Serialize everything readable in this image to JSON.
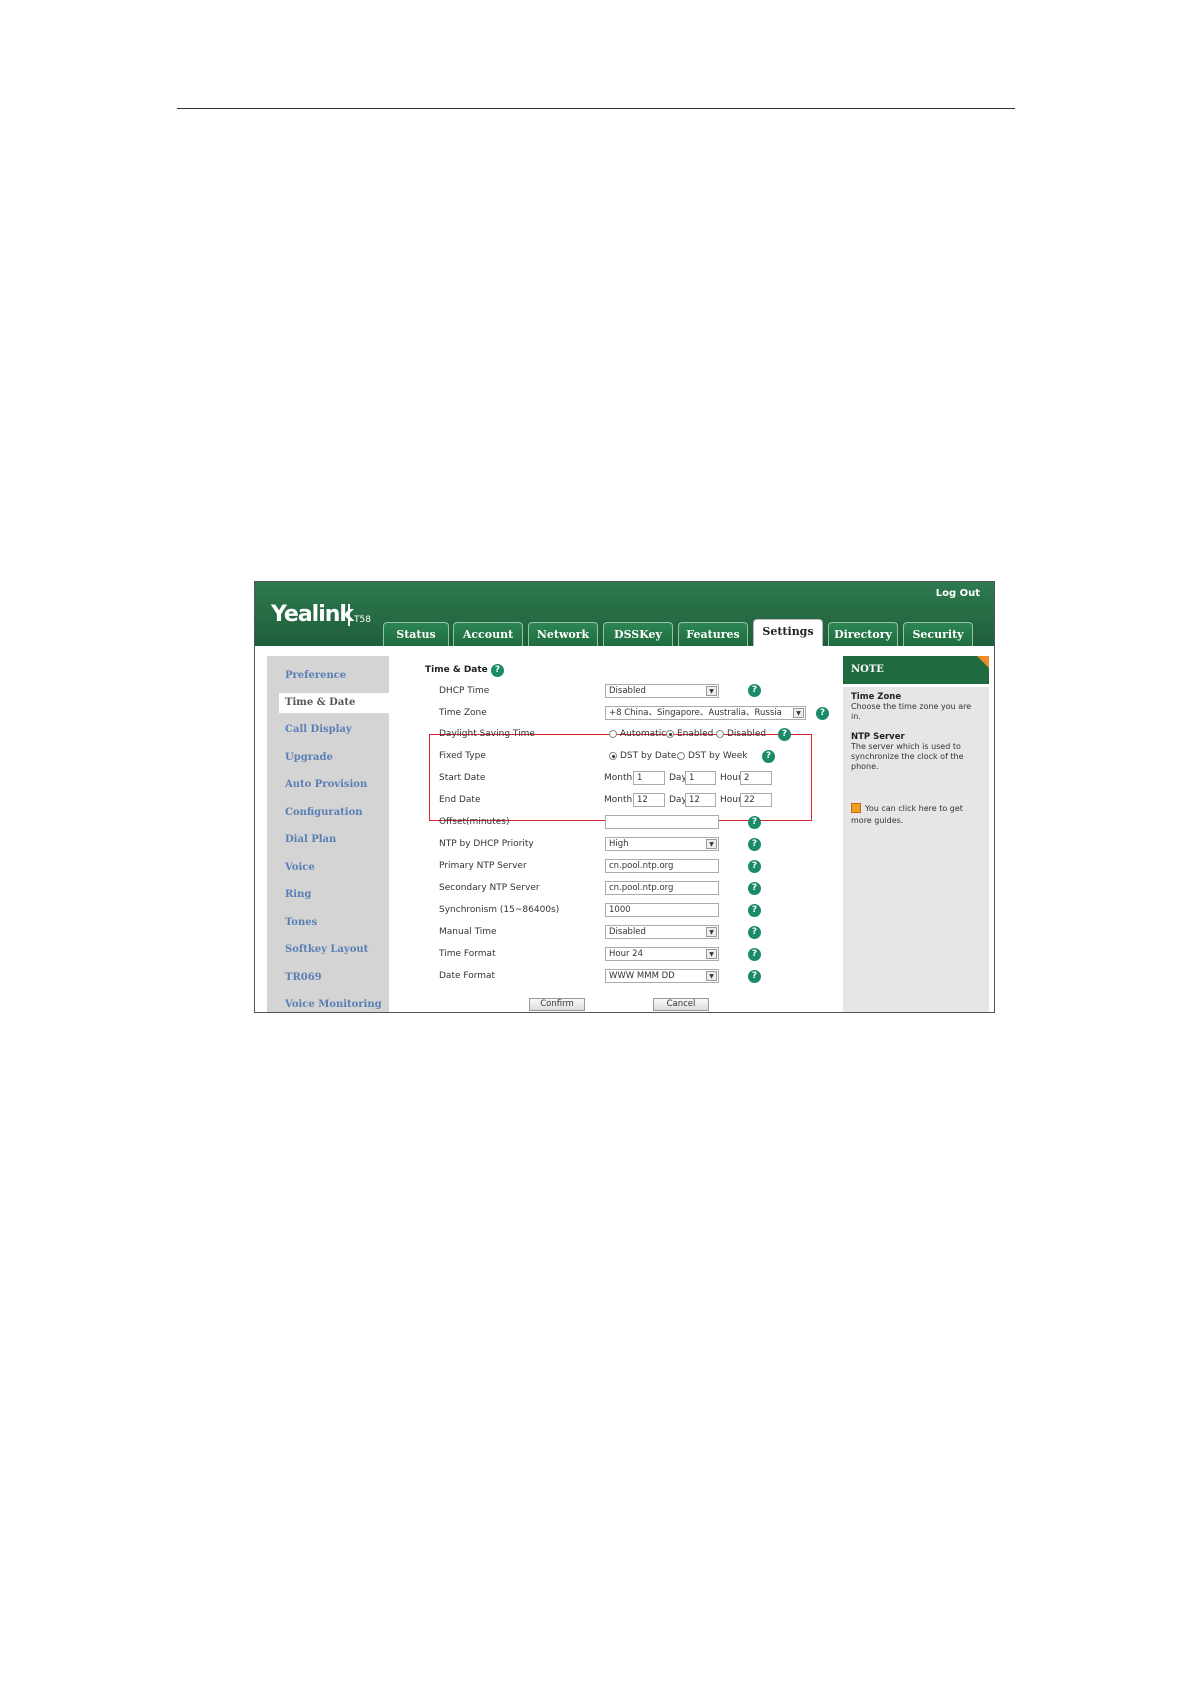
{
  "header": {
    "logo": "Yealink",
    "model": "T58",
    "logout": "Log Out",
    "tabs": [
      "Status",
      "Account",
      "Network",
      "DSSKey",
      "Features",
      "Settings",
      "Directory",
      "Security"
    ],
    "active_tab": "Settings"
  },
  "sidebar": {
    "items": [
      "Preference",
      "Time & Date",
      "Call Display",
      "Upgrade",
      "Auto Provision",
      "Configuration",
      "Dial Plan",
      "Voice",
      "Ring",
      "Tones",
      "Softkey Layout",
      "TR069",
      "Voice Monitoring"
    ],
    "active": "Time & Date"
  },
  "main": {
    "section_title": "Time & Date",
    "help_glyph": "?",
    "dhcp_time": {
      "label": "DHCP Time",
      "value": "Disabled"
    },
    "time_zone": {
      "label": "Time Zone",
      "value": "+8 China、Singapore、Australia、Russia"
    },
    "dst": {
      "label": "Daylight Saving Time",
      "options": [
        "Automatic",
        "Enabled",
        "Disabled"
      ],
      "selected": "Enabled"
    },
    "fixed_type": {
      "label": "Fixed Type",
      "options": [
        "DST by Date",
        "DST by Week"
      ],
      "selected": "DST by Date"
    },
    "start_date": {
      "label": "Start Date",
      "month_label": "Month",
      "month": "1",
      "day_label": "Day",
      "day": "1",
      "hour_label": "Hour",
      "hour": "2"
    },
    "end_date": {
      "label": "End Date",
      "month_label": "Month",
      "month": "12",
      "day_label": "Day",
      "day": "12",
      "hour_label": "Hour",
      "hour": "22"
    },
    "offset": {
      "label": "Offset(minutes)",
      "value": ""
    },
    "ntp_dhcp_priority": {
      "label": "NTP by DHCP Priority",
      "value": "High"
    },
    "primary_ntp": {
      "label": "Primary NTP Server",
      "value": "cn.pool.ntp.org"
    },
    "secondary_ntp": {
      "label": "Secondary NTP Server",
      "value": "cn.pool.ntp.org"
    },
    "synchronism": {
      "label": "Synchronism (15~86400s)",
      "value": "1000"
    },
    "manual_time": {
      "label": "Manual Time",
      "value": "Disabled"
    },
    "time_format": {
      "label": "Time Format",
      "value": "Hour 24"
    },
    "date_format": {
      "label": "Date Format",
      "value": "WWW MMM DD"
    },
    "confirm_label": "Confirm",
    "cancel_label": "Cancel",
    "colors": {
      "highlight_box": "#d9262d",
      "help_icon": "#1a8a6a"
    }
  },
  "note": {
    "heading": "NOTE",
    "time_zone_title": "Time Zone",
    "time_zone_text": "Choose the time zone you are in.",
    "ntp_title": "NTP Server",
    "ntp_text": "The server which is used to synchronize the clock of the phone.",
    "guide_text": "You can click here to get more guides."
  },
  "colors": {
    "header_green": "#1e5e3a",
    "sidebar_link": "#5a7fb5",
    "note_corner": "#f08a24"
  }
}
